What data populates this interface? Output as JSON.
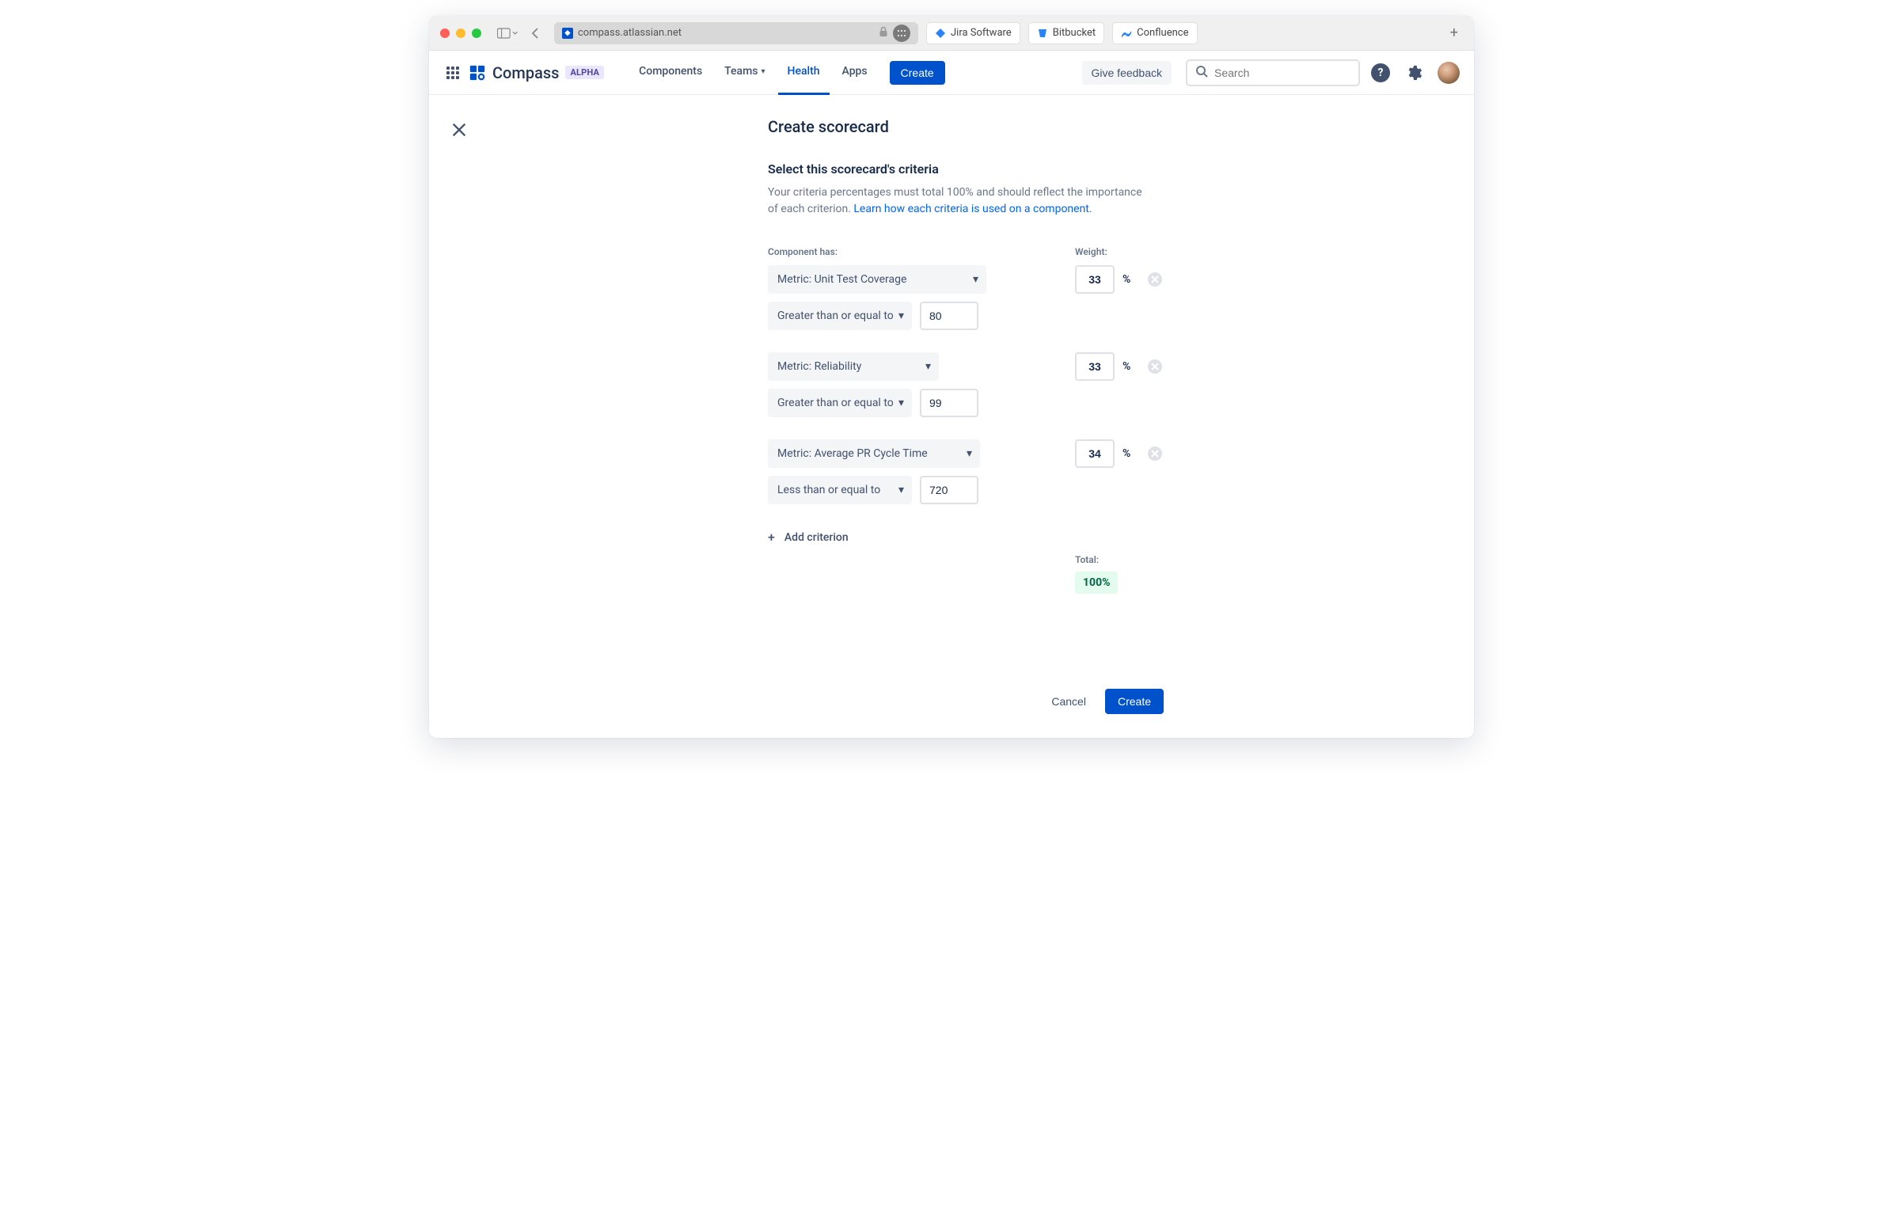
{
  "browser": {
    "url": "compass.atlassian.net",
    "favorites": [
      {
        "name": "Jira Software",
        "iconColor": "#2684FF"
      },
      {
        "name": "Bitbucket",
        "iconColor": "#2684FF"
      },
      {
        "name": "Confluence",
        "iconColor": "#2684FF"
      }
    ]
  },
  "header": {
    "product": "Compass",
    "badge": "ALPHA",
    "nav": {
      "components": "Components",
      "teams": "Teams",
      "health": "Health",
      "apps": "Apps"
    },
    "create": "Create",
    "feedback": "Give feedback",
    "searchPlaceholder": "Search"
  },
  "page": {
    "title": "Create scorecard",
    "sectionTitle": "Select this scorecard's criteria",
    "descPart1": "Your criteria percentages must total 100% and should reflect the importance of each criterion. ",
    "descLink": "Learn how each criteria is used on a component.",
    "labels": {
      "componentHas": "Component has:",
      "weight": "Weight:",
      "total": "Total:"
    },
    "criteria": [
      {
        "metric": "Metric: Unit Test Coverage",
        "operator": "Greater than or equal to",
        "value": "80",
        "weight": "33"
      },
      {
        "metric": "Metric: Reliability",
        "operator": "Greater than or equal to",
        "value": "99",
        "weight": "33"
      },
      {
        "metric": "Metric: Average PR Cycle Time",
        "operator": "Less than or equal to",
        "value": "720",
        "weight": "34"
      }
    ],
    "addCriterion": "Add criterion",
    "total": "100%",
    "pctSymbol": "%",
    "cancel": "Cancel",
    "submit": "Create"
  }
}
